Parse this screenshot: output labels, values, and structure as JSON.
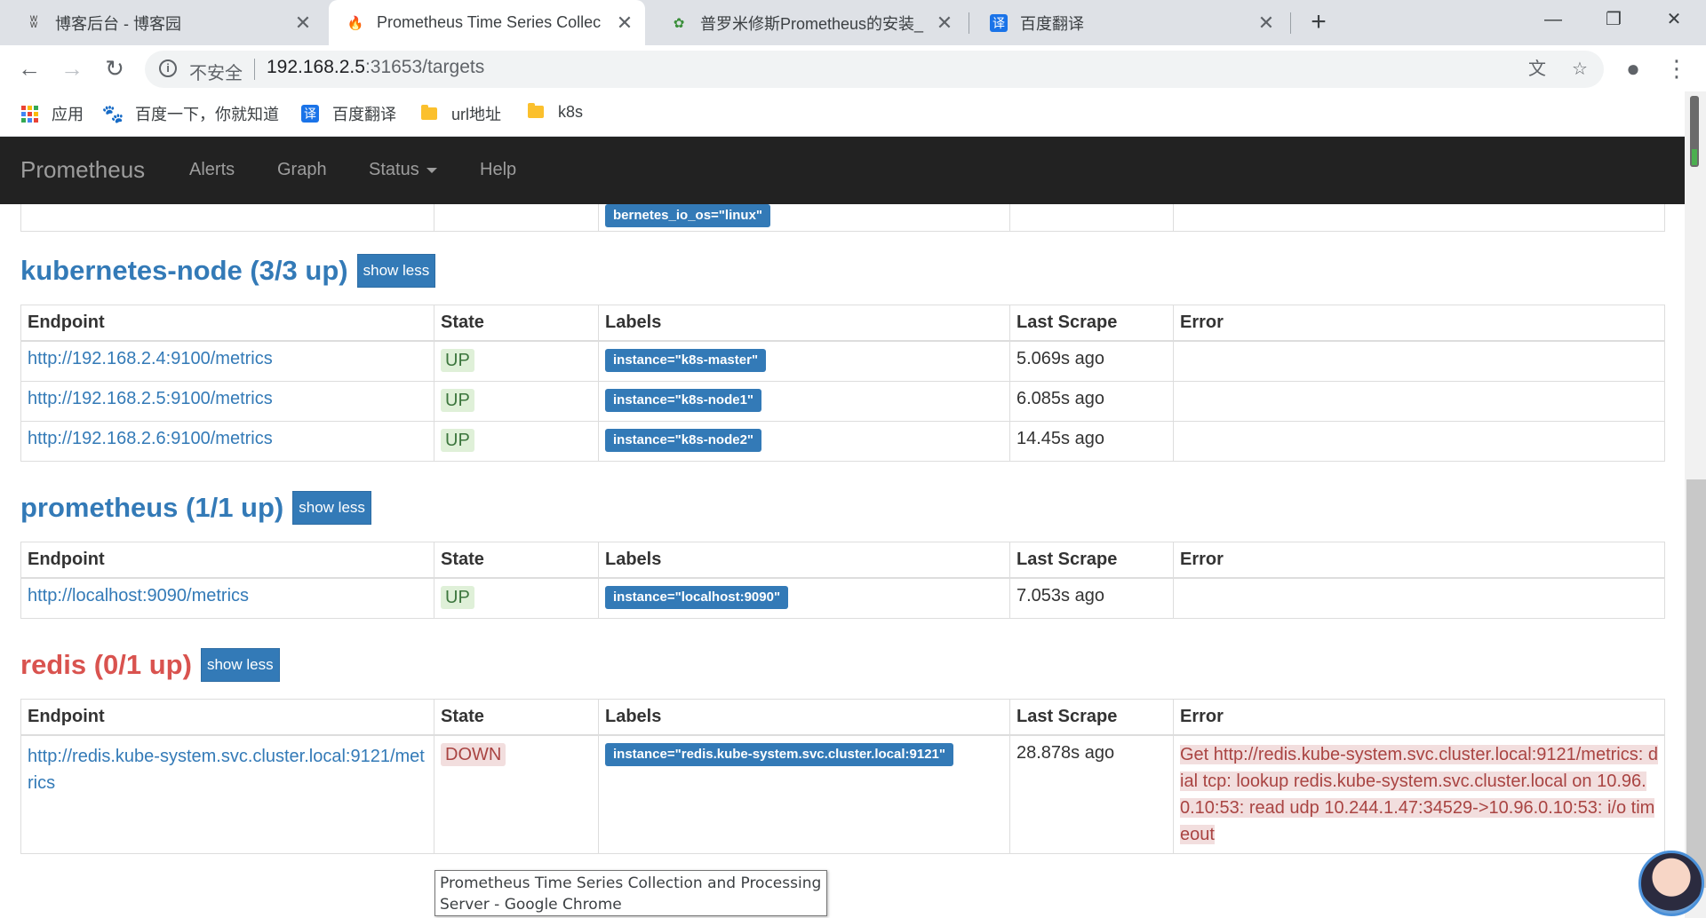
{
  "browser": {
    "tabs": [
      {
        "title": "博客后台 - 博客园",
        "active": false
      },
      {
        "title": "Prometheus Time Series Collec",
        "active": true
      },
      {
        "title": "普罗米修斯Prometheus的安装_",
        "active": false
      },
      {
        "title": "百度翻译",
        "active": false
      }
    ],
    "address": {
      "insecure_label": "不安全",
      "host": "192.168.2.5",
      "path": ":31653/targets"
    },
    "bookmarks": [
      {
        "label": "应用",
        "icon": "apps-grid-icon"
      },
      {
        "label": "百度一下，你就知道",
        "icon": "baidu-paw-icon"
      },
      {
        "label": "百度翻译",
        "icon": "translate-icon"
      },
      {
        "label": "url地址",
        "icon": "folder-icon"
      },
      {
        "label": "k8s",
        "icon": "folder-icon"
      }
    ],
    "tooltip": "Prometheus Time Series Collection and Processing Server - Google Chrome"
  },
  "navbar": {
    "brand": "Prometheus",
    "links": [
      "Alerts",
      "Graph",
      "Status",
      "Help"
    ]
  },
  "partial_row_label": "bernetes_io_os=\"linux\"",
  "table_headers": [
    "Endpoint",
    "State",
    "Labels",
    "Last Scrape",
    "Error"
  ],
  "jobs": [
    {
      "title": "kubernetes-node (3/3 up)",
      "button": "show less",
      "rows": [
        {
          "endpoint": "http://192.168.2.4:9100/metrics",
          "state": "UP",
          "label": "instance=\"k8s-master\"",
          "last_scrape": "5.069s ago",
          "error": ""
        },
        {
          "endpoint": "http://192.168.2.5:9100/metrics",
          "state": "UP",
          "label": "instance=\"k8s-node1\"",
          "last_scrape": "6.085s ago",
          "error": ""
        },
        {
          "endpoint": "http://192.168.2.6:9100/metrics",
          "state": "UP",
          "label": "instance=\"k8s-node2\"",
          "last_scrape": "14.45s ago",
          "error": ""
        }
      ]
    },
    {
      "title": "prometheus (1/1 up)",
      "button": "show less",
      "rows": [
        {
          "endpoint": "http://localhost:9090/metrics",
          "state": "UP",
          "label": "instance=\"localhost:9090\"",
          "last_scrape": "7.053s ago",
          "error": ""
        }
      ]
    },
    {
      "title": "redis (0/1 up)",
      "button": "show less",
      "rows": [
        {
          "endpoint": "http://redis.kube-system.svc.cluster.local:9121/metrics",
          "state": "DOWN",
          "label": "instance=\"redis.kube-system.svc.cluster.local:9121\"",
          "last_scrape": "28.878s ago",
          "error": "Get http://redis.kube-system.svc.cluster.local:9121/metrics: dial tcp: lookup redis.kube-system.svc.cluster.local on 10.96.0.10:53: read udp 10.244.1.47:34529->10.96.0.10:53: i/o timeout"
        }
      ]
    }
  ],
  "colors": {
    "link": "#337ab7",
    "navbar_bg": "#222222",
    "up_bg": "#dff0d8",
    "down_bg": "#f2dede",
    "down_text": "#a94442",
    "job_down_title": "#d9534f"
  }
}
